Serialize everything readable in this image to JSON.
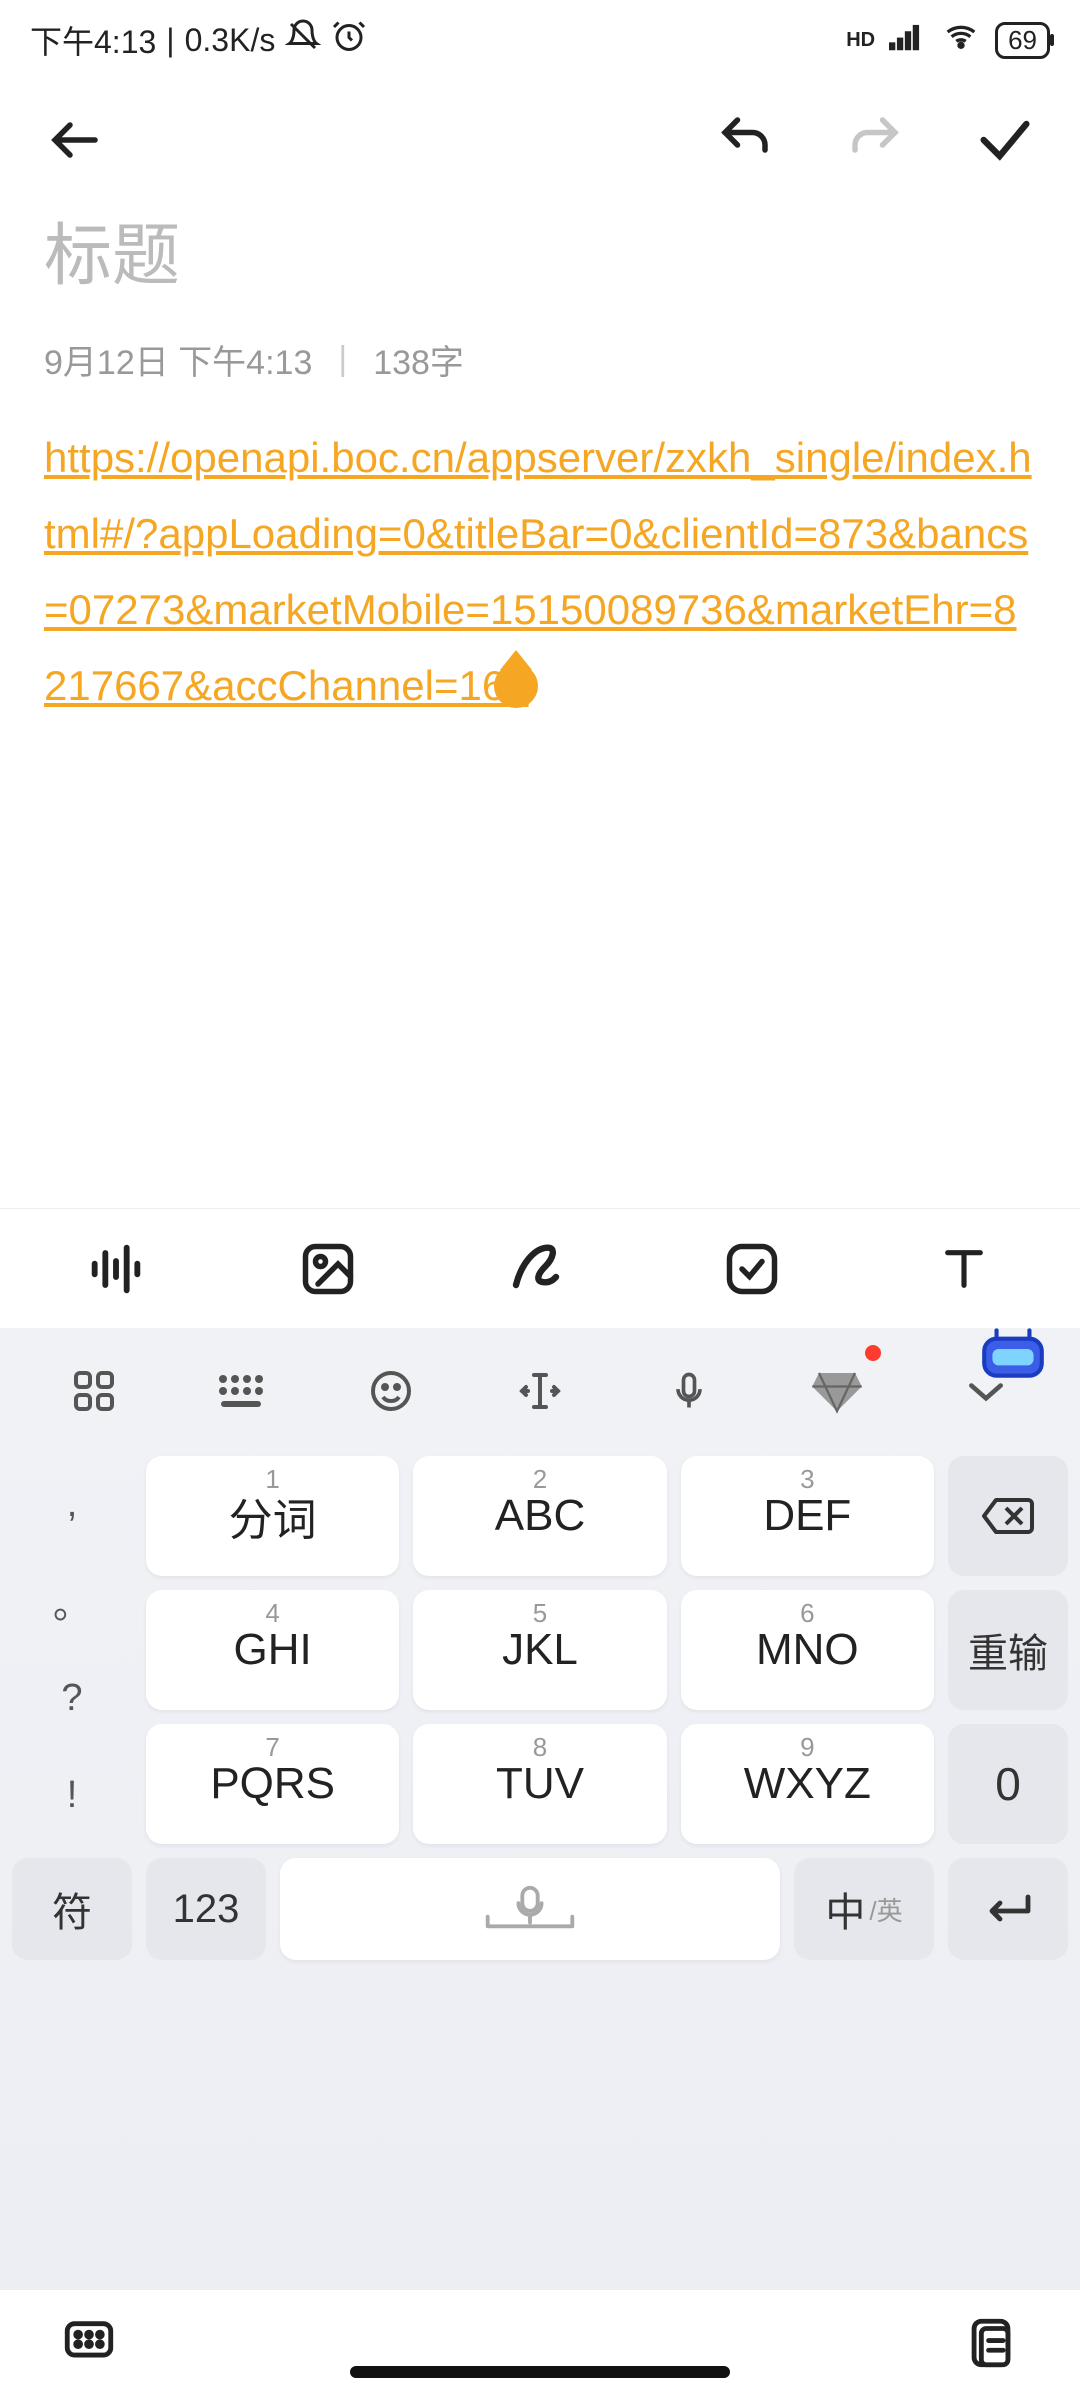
{
  "status": {
    "time": "下午4:13",
    "speed": "0.3K/s",
    "battery": "69",
    "hd": "HD"
  },
  "header": {
    "back": "back",
    "undo": "undo",
    "redo": "redo",
    "confirm": "confirm"
  },
  "note": {
    "title_placeholder": "标题",
    "date": "9月12日 下午4:13",
    "word_count": "138字",
    "content_link": "https://openapi.boc.cn/appserver/zxkh_single/index.html#/?appLoading=0&titleBar=0&clientId=873&bancs=07273&marketMobile=15150089736&marketEhr=8217667&accChannel=161"
  },
  "toolbar": {
    "voice": "voice-wave",
    "image": "image",
    "draw": "draw",
    "checklist": "checklist",
    "text": "text-format"
  },
  "keyboard": {
    "toprow": {
      "apps": "apps",
      "kb": "keyboard-switch",
      "emoji": "emoji",
      "cursor": "cursor",
      "mic": "mic",
      "diamond": "diamond",
      "collapse": "collapse"
    },
    "left_side": [
      ",",
      "。",
      "?",
      "!"
    ],
    "keys": [
      {
        "num": "1",
        "label": "分词"
      },
      {
        "num": "2",
        "label": "ABC"
      },
      {
        "num": "3",
        "label": "DEF"
      },
      {
        "num": "4",
        "label": "GHI"
      },
      {
        "num": "5",
        "label": "JKL"
      },
      {
        "num": "6",
        "label": "MNO"
      },
      {
        "num": "7",
        "label": "PQRS"
      },
      {
        "num": "8",
        "label": "TUV"
      },
      {
        "num": "9",
        "label": "WXYZ"
      }
    ],
    "right_side": {
      "backspace": "⌫",
      "reinput": "重输",
      "zero": "0"
    },
    "bottom": {
      "symbol": "符",
      "num": "123",
      "lang_main": "中",
      "lang_sub": "/英",
      "enter": "↵"
    }
  }
}
